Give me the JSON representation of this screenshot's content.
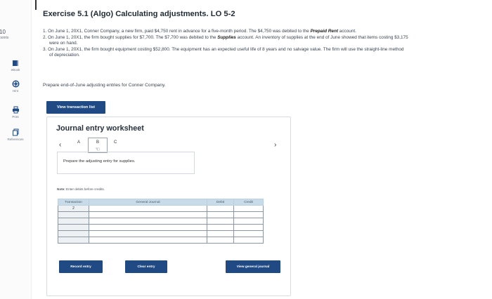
{
  "score": {
    "value": "10",
    "unit": "points"
  },
  "sidebar": {
    "items": [
      {
        "label": "eBook"
      },
      {
        "label": "Hint"
      },
      {
        "label": "Print"
      },
      {
        "label": "References"
      }
    ]
  },
  "exercise": {
    "title": "Exercise 5.1 (Algo) Calculating adjustments. LO 5-2",
    "items": [
      {
        "pre": "1. On June 1, 20X1, Conner Company, a new firm, paid $4,750 rent in advance for a five-month period. The $4,750 was debited to the ",
        "emph": "Prepaid Rent",
        "post": " account."
      },
      {
        "pre": "2. On June 1, 20X1, the firm bought supplies for $7,700. The $7,700 was debited to the ",
        "emph": "Supplies",
        "post": " account. An inventory of supplies at the end of June showed that items costing $3,175 were on hand."
      },
      {
        "pre": "3. On June 1, 20X1, the firm bought equipment costing $52,800. The equipment has an expected useful life of 8 years and no salvage value. The firm will use the straight-line method of depreciation.",
        "emph": "",
        "post": ""
      }
    ],
    "prompt": "Prepare end-of-June adjusting entries for Conner Company."
  },
  "view_transaction_label": "View transaction list",
  "worksheet": {
    "title": "Journal entry worksheet",
    "tabs": [
      "A",
      "B",
      "C"
    ],
    "active_tab": "B",
    "instruction": "Prepare the adjusting entry for supplies.",
    "note_prefix": "Note:",
    "note_text": "Enter debits before credits.",
    "columns": [
      "Transaction",
      "General Journal",
      "Debit",
      "Credit"
    ],
    "rows": [
      {
        "transaction": "2",
        "account": "",
        "debit": "",
        "credit": ""
      },
      {
        "transaction": "",
        "account": "",
        "debit": "",
        "credit": ""
      },
      {
        "transaction": "",
        "account": "",
        "debit": "",
        "credit": ""
      },
      {
        "transaction": "",
        "account": "",
        "debit": "",
        "credit": ""
      },
      {
        "transaction": "",
        "account": "",
        "debit": "",
        "credit": ""
      },
      {
        "transaction": "",
        "account": "",
        "debit": "",
        "credit": ""
      }
    ],
    "buttons": {
      "record": "Record entry",
      "clear": "Clear entry",
      "view_journal": "View general journal"
    }
  },
  "colors": {
    "primary_button": "#1f4a83",
    "table_header": "#c7dbe8"
  }
}
